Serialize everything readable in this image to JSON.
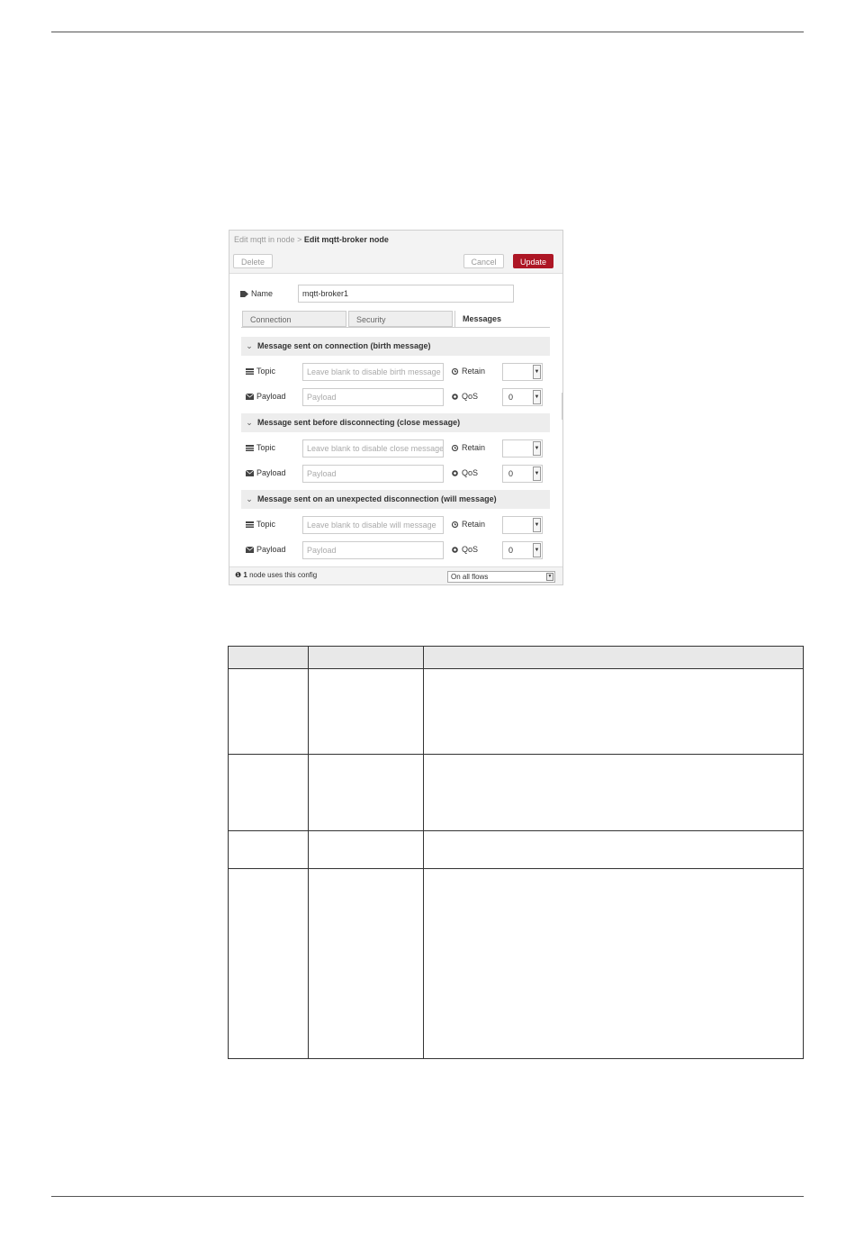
{
  "dialog": {
    "breadcrumb_prev": "Edit mqtt in node",
    "breadcrumb_sep": ">",
    "breadcrumb_current": "Edit mqtt-broker node",
    "delete_label": "Delete",
    "cancel_label": "Cancel",
    "update_label": "Update",
    "name_label": "Name",
    "name_value": "mqtt-broker1",
    "tabs": [
      "Connection",
      "Security",
      "Messages"
    ],
    "active_tab": "Messages",
    "sections": [
      {
        "title": "Message sent on connection (birth message)",
        "topic_label": "Topic",
        "topic_placeholder": "Leave blank to disable birth message",
        "retain_label": "Retain",
        "retain_value": "",
        "payload_label": "Payload",
        "payload_placeholder": "Payload",
        "qos_label": "QoS",
        "qos_value": "0"
      },
      {
        "title": "Message sent before disconnecting (close message)",
        "topic_label": "Topic",
        "topic_placeholder": "Leave blank to disable close message",
        "retain_label": "Retain",
        "retain_value": "",
        "payload_label": "Payload",
        "payload_placeholder": "Payload",
        "qos_label": "QoS",
        "qos_value": "0"
      },
      {
        "title": "Message sent on an unexpected disconnection (will message)",
        "topic_label": "Topic",
        "topic_placeholder": "Leave blank to disable will message",
        "retain_label": "Retain",
        "retain_value": "",
        "payload_label": "Payload",
        "payload_placeholder": "Payload",
        "qos_label": "QoS",
        "qos_value": "0"
      }
    ],
    "footer_info_count": "1",
    "footer_info_text": "node uses this config",
    "flows_value": "On all flows"
  },
  "colors": {
    "primary": "#ad1625",
    "header_bg": "#f3f3f3",
    "section_bg": "#ededed"
  }
}
